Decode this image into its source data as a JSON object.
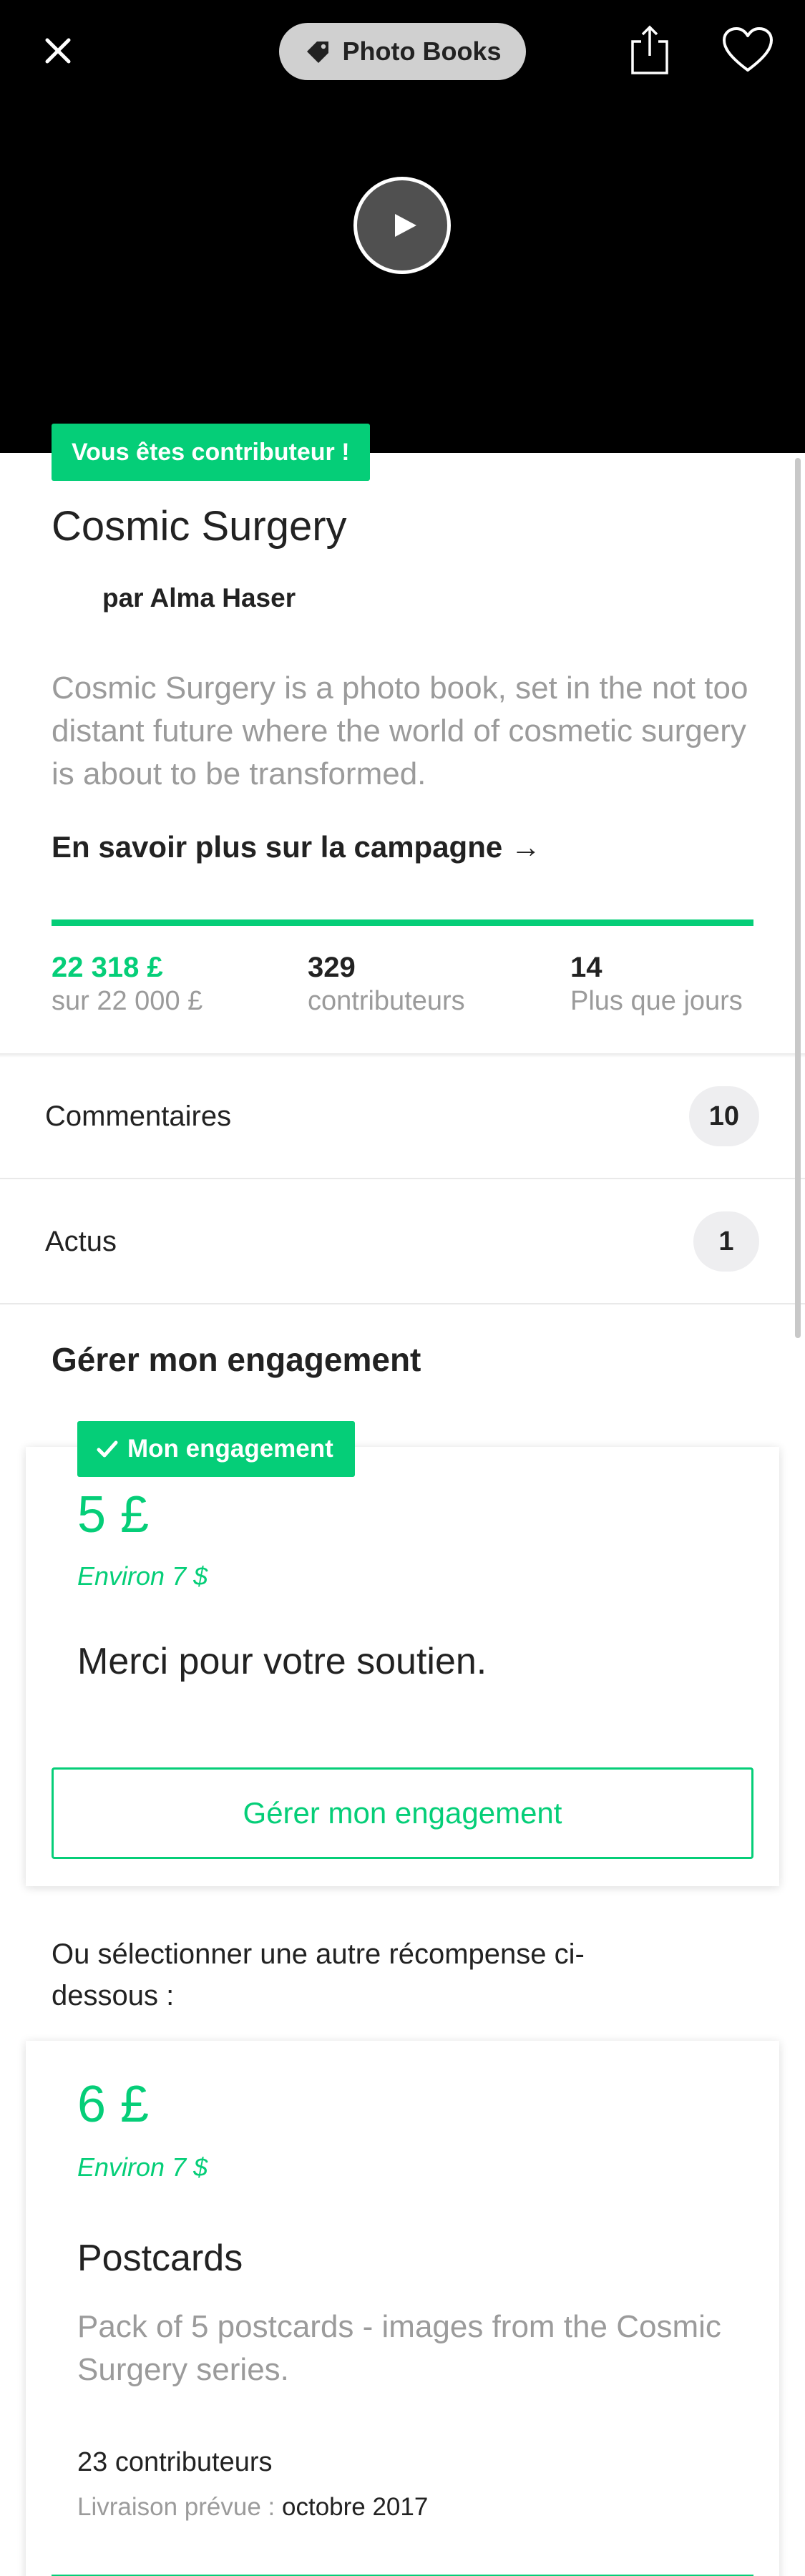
{
  "header": {
    "category": "Photo Books"
  },
  "project": {
    "badge": "Vous êtes contributeur !",
    "title": "Cosmic Surgery",
    "byline": "par Alma Haser",
    "blurb": "Cosmic Surgery is a photo book, set in the not too distant future where the world of cosmetic surgery is about to be transformed.",
    "learn_more": "En savoir plus sur la campagne →",
    "progress_percent": 100,
    "stats": {
      "pledged": "22 318 £",
      "goal": "sur 22 000 £",
      "backers": "329",
      "backers_label": "contributeurs",
      "days": "14",
      "days_label": "Plus que jours"
    }
  },
  "rows": {
    "comments_label": "Commentaires",
    "comments_count": "10",
    "updates_label": "Actus",
    "updates_count": "1"
  },
  "pledge": {
    "section_title": "Gérer mon engagement",
    "badge": "Mon engagement",
    "amount": "5 £",
    "approx": "Environ 7 $",
    "thanks": "Merci pour votre soutien.",
    "manage_button": "Gérer mon engagement"
  },
  "alt_prompt": "Ou sélectionner une autre récompense ci-dessous :",
  "reward": {
    "amount": "6 £",
    "approx": "Environ 7 $",
    "title": "Postcards",
    "description": "Pack of 5 postcards - images from the Cosmic Surgery series.",
    "backers": "23 contributeurs",
    "delivery_label": "Livraison prévue :",
    "delivery_value": "octobre 2017"
  },
  "colors": {
    "accent": "#05ce78",
    "text": "#222222",
    "muted": "#9b9b9b",
    "hero_bg": "#000000"
  },
  "icons": [
    "close-icon",
    "tag-icon",
    "share-icon",
    "heart-icon",
    "play-icon",
    "check-icon"
  ]
}
